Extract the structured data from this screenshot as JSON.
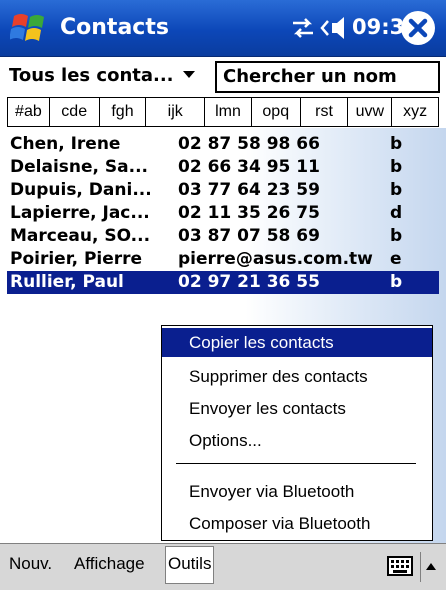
{
  "titlebar": {
    "app_title": "Contacts",
    "clock": "09:38",
    "icons": [
      "windows-start-icon",
      "sync-icon",
      "speaker-icon",
      "close-icon"
    ]
  },
  "filter": {
    "category": "Tous les conta...",
    "search_value": "Chercher un nom"
  },
  "letter_tabs": [
    "#ab",
    "cde",
    "fgh",
    "ijk",
    "lmn",
    "opq",
    "rst",
    "uvw",
    "xyz"
  ],
  "contacts": [
    {
      "name": "Chen, Irene",
      "detail": "02 87 58 98 66",
      "type": "b"
    },
    {
      "name": "Delaisne, Sa...",
      "detail": "02 66 34 95 11",
      "type": "b"
    },
    {
      "name": "Dupuis, Dani...",
      "detail": "03 77 64 23 59",
      "type": "b"
    },
    {
      "name": "Lapierre, Jac...",
      "detail": "02 11 35 26 75",
      "type": "d"
    },
    {
      "name": "Marceau, SO...",
      "detail": "03 87 07 58 69",
      "type": "b"
    },
    {
      "name": "Poirier, Pierre",
      "detail": "pierre@asus.com.tw",
      "type": "e"
    },
    {
      "name": "Rullier, Paul",
      "detail": "02 97 21 36 55",
      "type": "b"
    }
  ],
  "context_menu": {
    "items": [
      "Copier les contacts",
      "Supprimer des contacts",
      "Envoyer les contacts",
      "Options...",
      "Envoyer via Bluetooth",
      "Composer via Bluetooth"
    ]
  },
  "bottom_bar": {
    "menus": [
      "Nouv.",
      "Affichage",
      "Outils"
    ]
  },
  "colors": {
    "titlebar": "#0c47b8",
    "selection": "#0a1f8f"
  }
}
